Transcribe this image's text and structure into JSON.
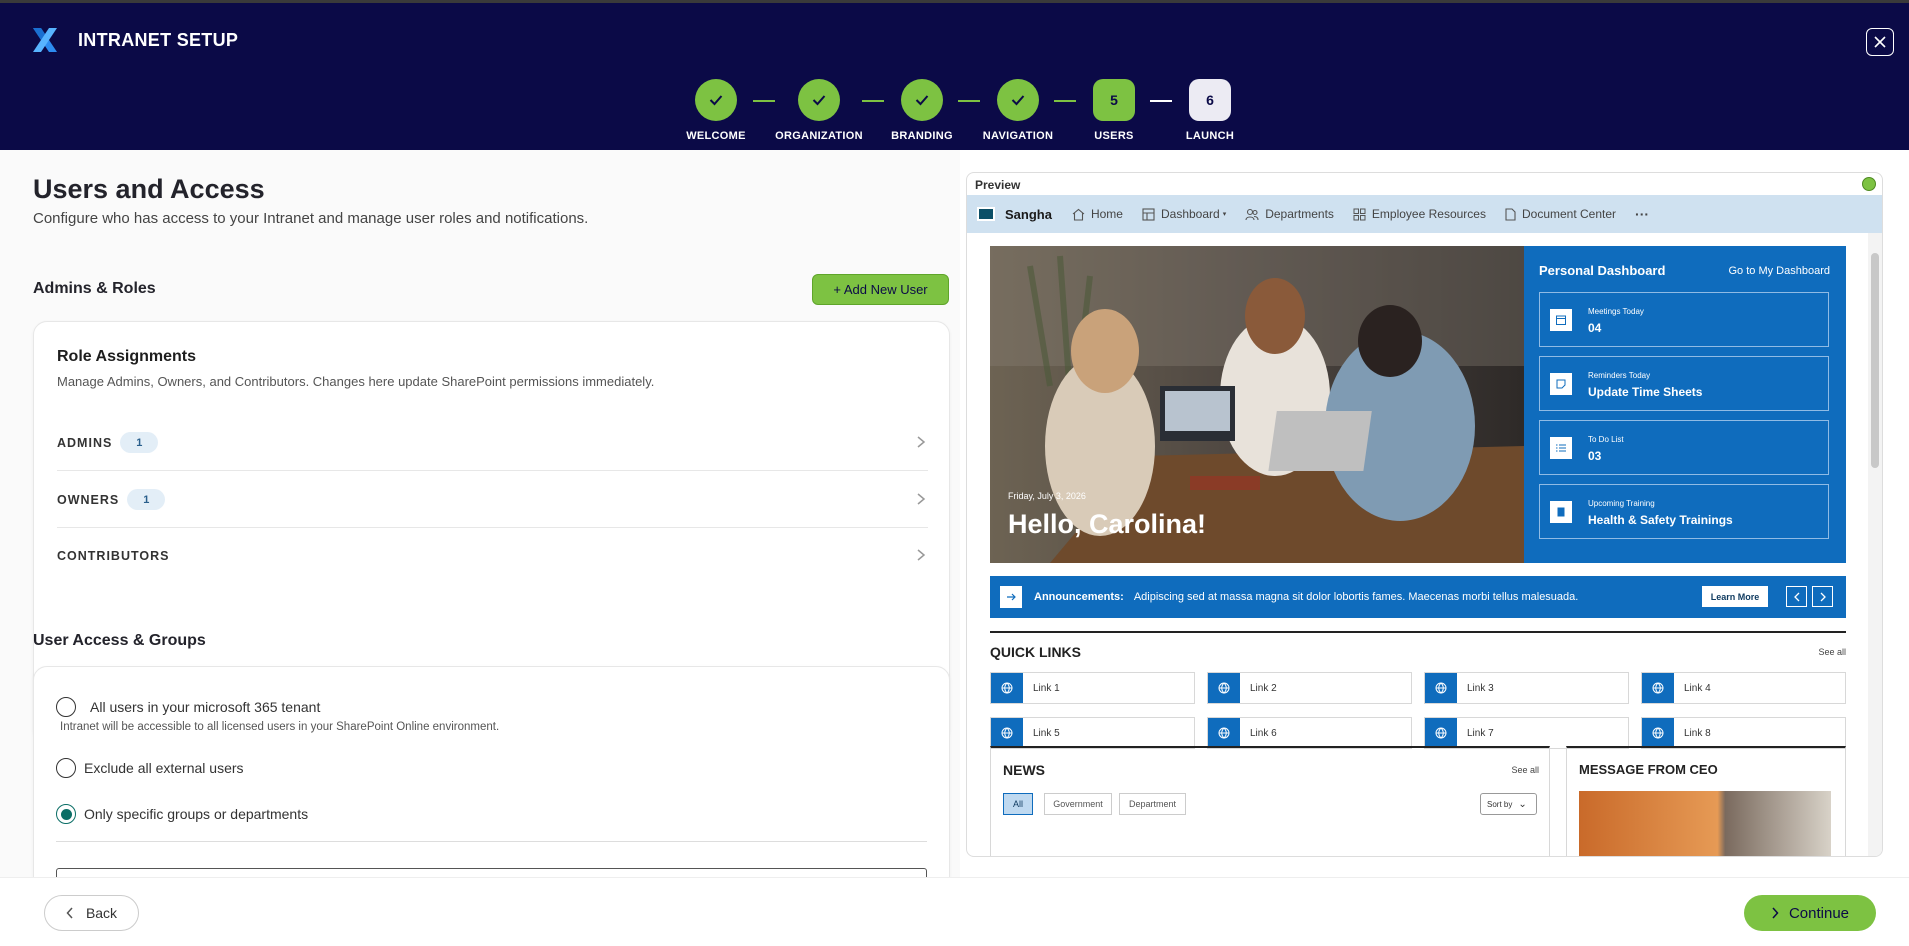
{
  "app": {
    "title": "INTRANET SETUP"
  },
  "steps": [
    {
      "label": "WELCOME",
      "state": "done"
    },
    {
      "label": "ORGANIZATION",
      "state": "done"
    },
    {
      "label": "BRANDING",
      "state": "done"
    },
    {
      "label": "NAVIGATION",
      "state": "done"
    },
    {
      "label": "USERS",
      "number": "5",
      "state": "current"
    },
    {
      "label": "LAUNCH",
      "number": "6",
      "state": "pending"
    }
  ],
  "page": {
    "title": "Users and Access",
    "subtitle": "Configure who has access to your Intranet and manage user roles and notifications."
  },
  "admins_roles": {
    "heading": "Admins & Roles",
    "add_button": "+ Add New User",
    "card_title": "Role Assignments",
    "card_desc": "Manage Admins, Owners, and Contributors. Changes here update SharePoint permissions immediately.",
    "roles": [
      {
        "name": "ADMINS",
        "count": "1"
      },
      {
        "name": "OWNERS",
        "count": "1"
      },
      {
        "name": "CONTRIBUTORS",
        "count": ""
      }
    ]
  },
  "access": {
    "heading": "User Access & Groups",
    "options": [
      {
        "label": "All users in your microsoft 365 tenant",
        "hint": "Intranet will be accessible to all licensed users in your SharePoint Online environment.",
        "selected": false
      },
      {
        "label": "Exclude all external users",
        "selected": false
      },
      {
        "label": "Only specific groups or departments",
        "selected": true
      }
    ]
  },
  "preview": {
    "label": "Preview",
    "site_name": "Sangha",
    "nav": [
      "Home",
      "Dashboard",
      "Departments",
      "Employee Resources",
      "Document Center"
    ],
    "more": "···",
    "hero": {
      "date": "Friday, July 3, 2026",
      "greeting": "Hello, Carolina!"
    },
    "dashboard": {
      "title": "Personal Dashboard",
      "link": "Go to My Dashboard",
      "tiles": [
        {
          "label": "Meetings Today",
          "value": "04",
          "icon": "calendar-icon"
        },
        {
          "label": "Reminders Today",
          "value": "Update Time Sheets",
          "icon": "note-icon"
        },
        {
          "label": "To Do List",
          "value": "03",
          "icon": "checklist-icon"
        },
        {
          "label": "Upcoming Training",
          "value": "Health & Safety Trainings",
          "icon": "book-icon"
        }
      ]
    },
    "announcement": {
      "heading": "Announcements:",
      "text": "Adipiscing sed at massa magna sit dolor lobortis fames. Maecenas morbi tellus malesuada.",
      "button": "Learn More"
    },
    "quick_links": {
      "title": "QUICK LINKS",
      "see_all": "See all",
      "links": [
        "Link 1",
        "Link 2",
        "Link 3",
        "Link 4",
        "Link 5",
        "Link 6",
        "Link 7",
        "Link 8"
      ]
    },
    "news": {
      "title": "NEWS",
      "see_all": "See all",
      "filters": [
        "All",
        "Government",
        "Department"
      ],
      "sort": "Sort by"
    },
    "ceo": {
      "title": "MESSAGE FROM CEO"
    }
  },
  "footer": {
    "back": "Back",
    "continue": "Continue"
  },
  "colors": {
    "navy": "#0b0a47",
    "accent_green": "#7dc242",
    "preview_blue": "#0f6cbd"
  }
}
